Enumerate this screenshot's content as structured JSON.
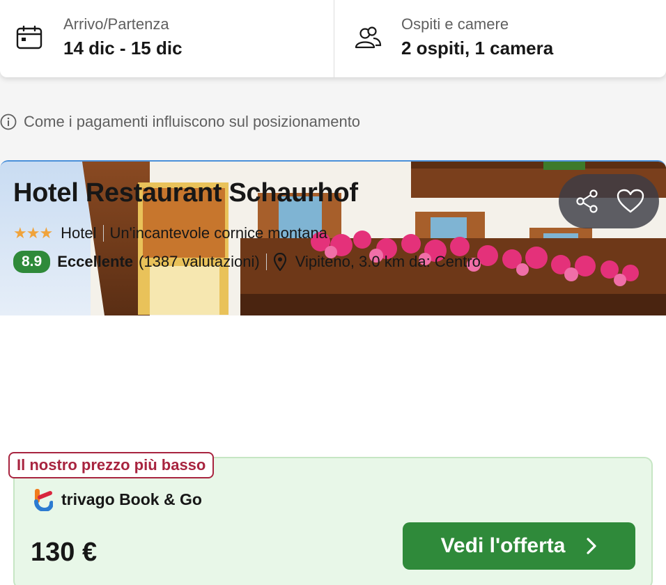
{
  "search": {
    "dates_label": "Arrivo/Partenza",
    "dates_value": "14 dic - 15 dic",
    "guests_label": "Ospiti e camere",
    "guests_value": "2 ospiti, 1 camera"
  },
  "info": {
    "text": "Come i pagamenti influiscono sul posizionamento"
  },
  "hotel": {
    "name": "Hotel Restaurant Schaurhof",
    "stars": "★★★",
    "star_count": 3,
    "type": "Hotel",
    "tagline": "Un'incantevole cornice montana",
    "rating": "8.9",
    "rating_label": "Eccellente",
    "reviews": "(1387 valutazioni)",
    "location": "Vipiteno, 3.0 km da: Centro"
  },
  "offer": {
    "tag": "Il nostro prezzo più basso",
    "provider": "trivago Book & Go",
    "price": "130 €",
    "cta_label": "Vedi l'offerta"
  },
  "icons": {
    "calendar": "calendar-icon",
    "guests": "users-icon",
    "info": "info-icon",
    "share": "share-icon",
    "favorite": "heart-icon",
    "location": "location-pin-icon",
    "chevron": "chevron-right-icon"
  },
  "colors": {
    "accent_green": "#2f8a3a",
    "tag_red": "#a8243f",
    "star_orange": "#f0a33b",
    "offer_bg": "#e8f7e8",
    "card_border": "#4a90d9"
  }
}
